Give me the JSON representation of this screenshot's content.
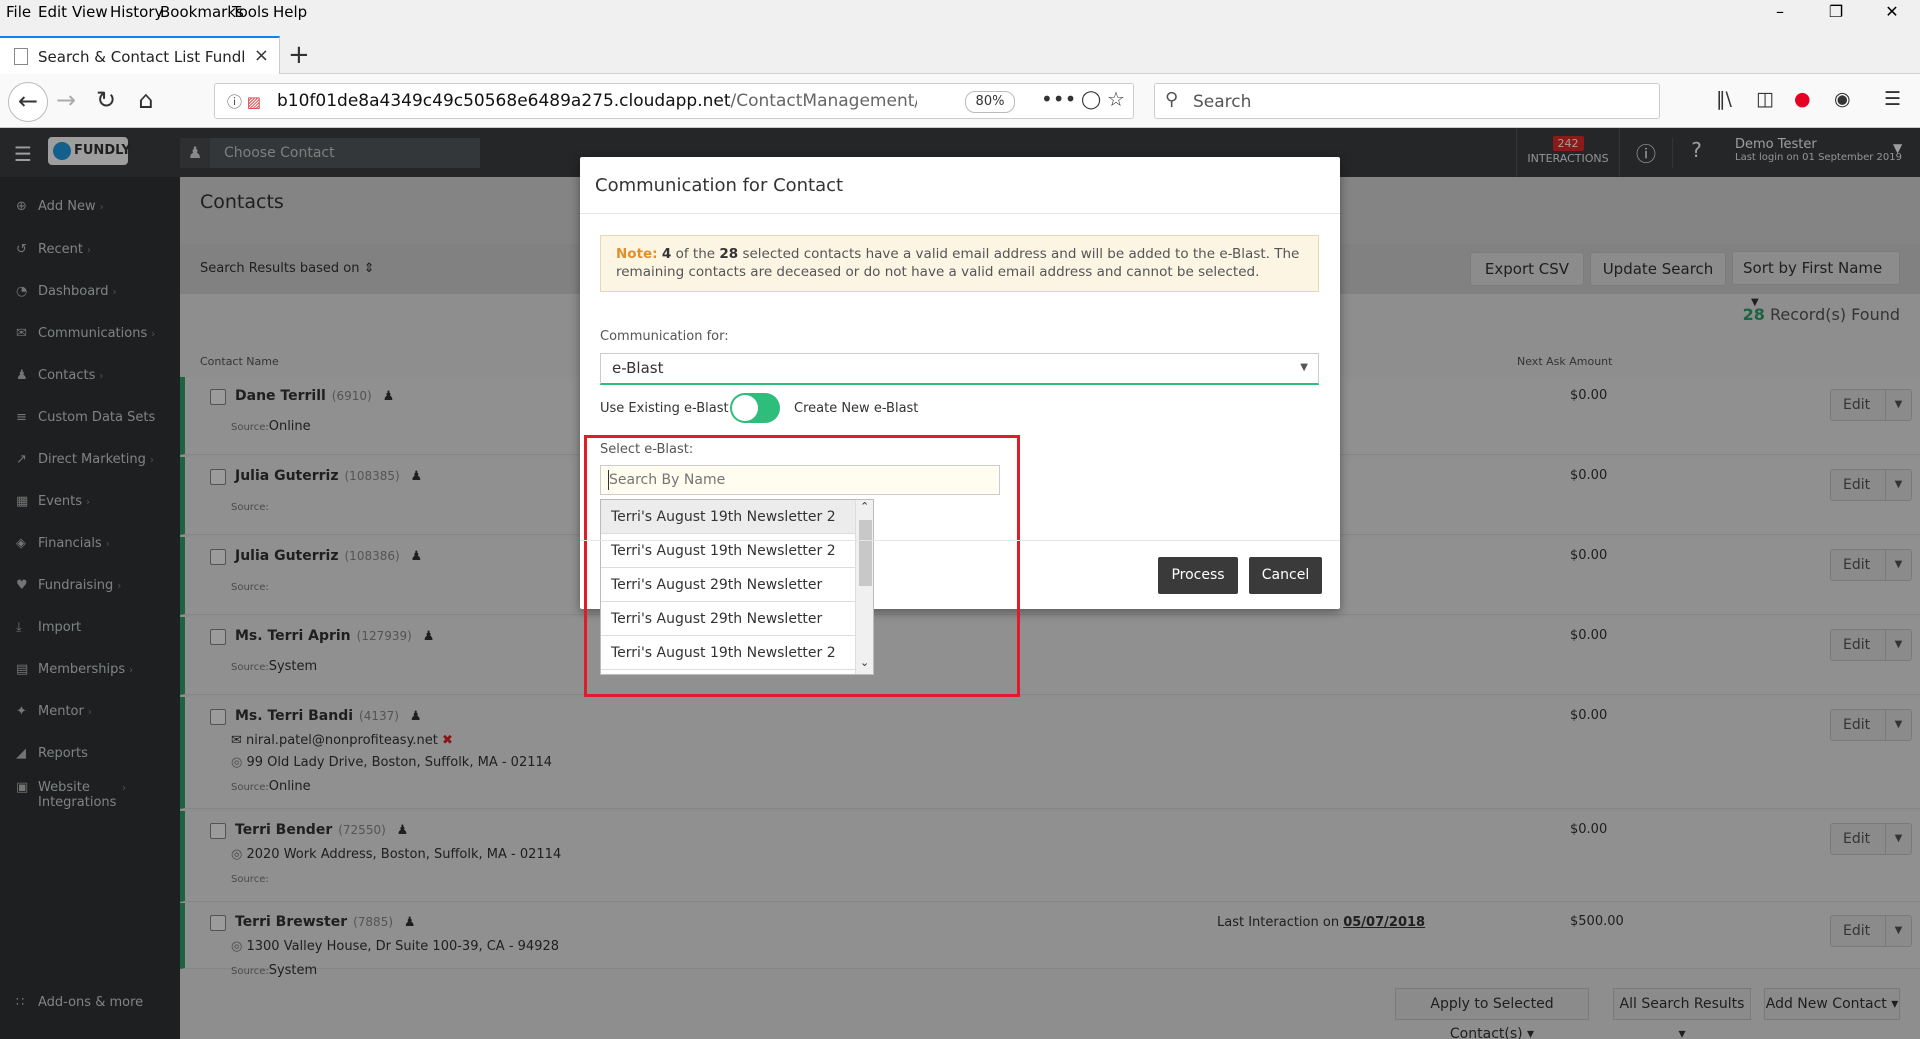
{
  "browser": {
    "menu": [
      "File",
      "Edit",
      "View",
      "History",
      "Bookmarks",
      "Tools",
      "Help"
    ],
    "tab_title": "Search & Contact List Fundly CR",
    "url_host": "b10f01de8a4349c49c50568e6489a275.cloudapp.net",
    "url_path": "/ContactManagement/List/Index",
    "zoom": "80%",
    "search_placeholder": "Search"
  },
  "app": {
    "logo_text": "FUNDLY",
    "choose_contact": "Choose Contact",
    "interactions_count": "242",
    "interactions_label": "INTERACTIONS",
    "user_name": "Demo Tester",
    "last_login": "Last login on 01 September 2019"
  },
  "sidebar": {
    "items": [
      {
        "label": "Add New",
        "icon": "plus-circle-icon"
      },
      {
        "label": "Recent",
        "icon": "history-icon"
      },
      {
        "label": "Dashboard",
        "icon": "dashboard-icon"
      },
      {
        "label": "Communications",
        "icon": "envelope-icon"
      },
      {
        "label": "Contacts",
        "icon": "user-icon"
      },
      {
        "label": "Custom Data Sets",
        "icon": "database-icon"
      },
      {
        "label": "Direct Marketing",
        "icon": "direct-marketing-icon"
      },
      {
        "label": "Events",
        "icon": "calendar-icon"
      },
      {
        "label": "Financials",
        "icon": "money-icon"
      },
      {
        "label": "Fundraising",
        "icon": "fundraising-icon"
      },
      {
        "label": "Import",
        "icon": "download-icon"
      },
      {
        "label": "Memberships",
        "icon": "id-card-icon"
      },
      {
        "label": "Mentor",
        "icon": "mentor-icon"
      },
      {
        "label": "Reports",
        "icon": "chart-icon"
      },
      {
        "label": "Website Integrations",
        "icon": "browser-icon"
      }
    ],
    "addons": "Add-ons & more"
  },
  "main": {
    "title": "Contacts",
    "search_results_based_on": "Search Results based on",
    "export_csv": "Export CSV",
    "update_search": "Update Search",
    "sort_by": "Sort by First Name",
    "records_count": "28",
    "records_label": "Record(s) Found",
    "col_contact_name": "Contact Name",
    "col_next_ask": "Next Ask Amount",
    "edit_label": "Edit",
    "source_label": "Source:",
    "rows": [
      {
        "name": "Dane Terrill",
        "id": "(6910)",
        "source": "Online",
        "amount": "$0.00"
      },
      {
        "name": "Julia Guterriz",
        "id": "(108385)",
        "source": "",
        "amount": "$0.00"
      },
      {
        "name": "Julia Guterriz",
        "id": "(108386)",
        "source": "",
        "amount": "$0.00"
      },
      {
        "name": "Ms. Terri Aprin",
        "id": "(127939)",
        "source": "System",
        "amount": "$0.00"
      },
      {
        "name": "Ms. Terri Bandi",
        "id": "(4137)",
        "email": "niral.patel@nonprofiteasy.net",
        "address": "99 Old Lady Drive, Boston, Suffolk, MA - 02114",
        "source": "Online",
        "amount": "$0.00"
      },
      {
        "name": "Terri Bender",
        "id": "(72550)",
        "address": "2020 Work Address, Boston, Suffolk, MA - 02114",
        "source": "",
        "amount": "$0.00"
      },
      {
        "name": "Terri Brewster",
        "id": "(7885)",
        "address": "1300 Valley House, Dr Suite 100-39, CA - 94928",
        "source": "System",
        "amount": "$500.00",
        "last_interaction_prefix": "Last Interaction on",
        "last_interaction_date": "05/07/2018"
      }
    ],
    "apply_selected": "Apply to Selected Contact(s)",
    "all_search_results": "All Search Results",
    "add_new_contact": "Add New Contact"
  },
  "modal": {
    "title": "Communication for Contact",
    "note_label": "Note:",
    "note_count": "4",
    "note_mid": "of the",
    "note_total": "28",
    "note_text": "selected contacts have a valid email address and will be added to the e-Blast. The remaining contacts are deceased or do not have a valid email address and cannot be selected.",
    "communication_for_label": "Communication for:",
    "communication_for_value": "e-Blast",
    "use_existing": "Use Existing e-Blast",
    "create_new": "Create New e-Blast",
    "toggle_state": "on",
    "select_eblast_label": "Select e-Blast:",
    "search_placeholder": "Search By Name",
    "options": [
      "Terri's August 19th Newsletter 2",
      "Terri's August 19th Newsletter 2",
      "Terri's August 29th Newsletter",
      "Terri's August 29th Newsletter",
      "Terri's August 19th Newsletter 2"
    ],
    "process": "Process",
    "cancel": "Cancel"
  },
  "colors": {
    "accent": "#2ebd7b",
    "highlight": "#e01c2b",
    "dark": "#2f3234"
  }
}
